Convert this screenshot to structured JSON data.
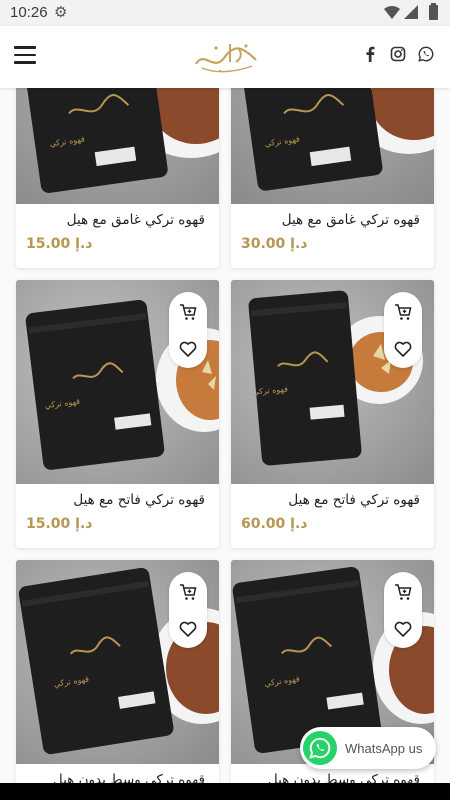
{
  "status_bar": {
    "time": "10:26"
  },
  "header": {
    "logo_alt": "Logo",
    "social": [
      "facebook-icon",
      "instagram-icon",
      "whatsapp-icon"
    ]
  },
  "products": [
    {
      "name": "قهوه تركي غامق مع هيل",
      "price": "15.00 د.إ",
      "bag_label": "قهوه تركي",
      "garnish": "ground-coffee"
    },
    {
      "name": "قهوه تركي غامق مع هيل",
      "price": "30.00 د.إ",
      "bag_label": "قهوه تركي",
      "garnish": "ground-coffee"
    },
    {
      "name": "قهوه تركي فاتح مع هيل",
      "price": "15.00 د.إ",
      "bag_label": "قهوه تركي",
      "garnish": "cardamom"
    },
    {
      "name": "قهوه تركي فاتح مع هيل",
      "price": "60.00 د.إ",
      "bag_label": "قهوه تركي",
      "garnish": "cardamom"
    },
    {
      "name": "قهوه تركي وسط بدون هيل",
      "price": "",
      "bag_label": "قهوه تركي",
      "garnish": "ground-coffee"
    },
    {
      "name": "قهوه تركي وسط بدون هيل",
      "price": "",
      "bag_label": "قهوه تركي",
      "garnish": "ground-coffee"
    }
  ],
  "whatsapp": {
    "label": "WhatsApp us"
  },
  "colors": {
    "accent": "#b69651",
    "whatsapp": "#25d366"
  }
}
